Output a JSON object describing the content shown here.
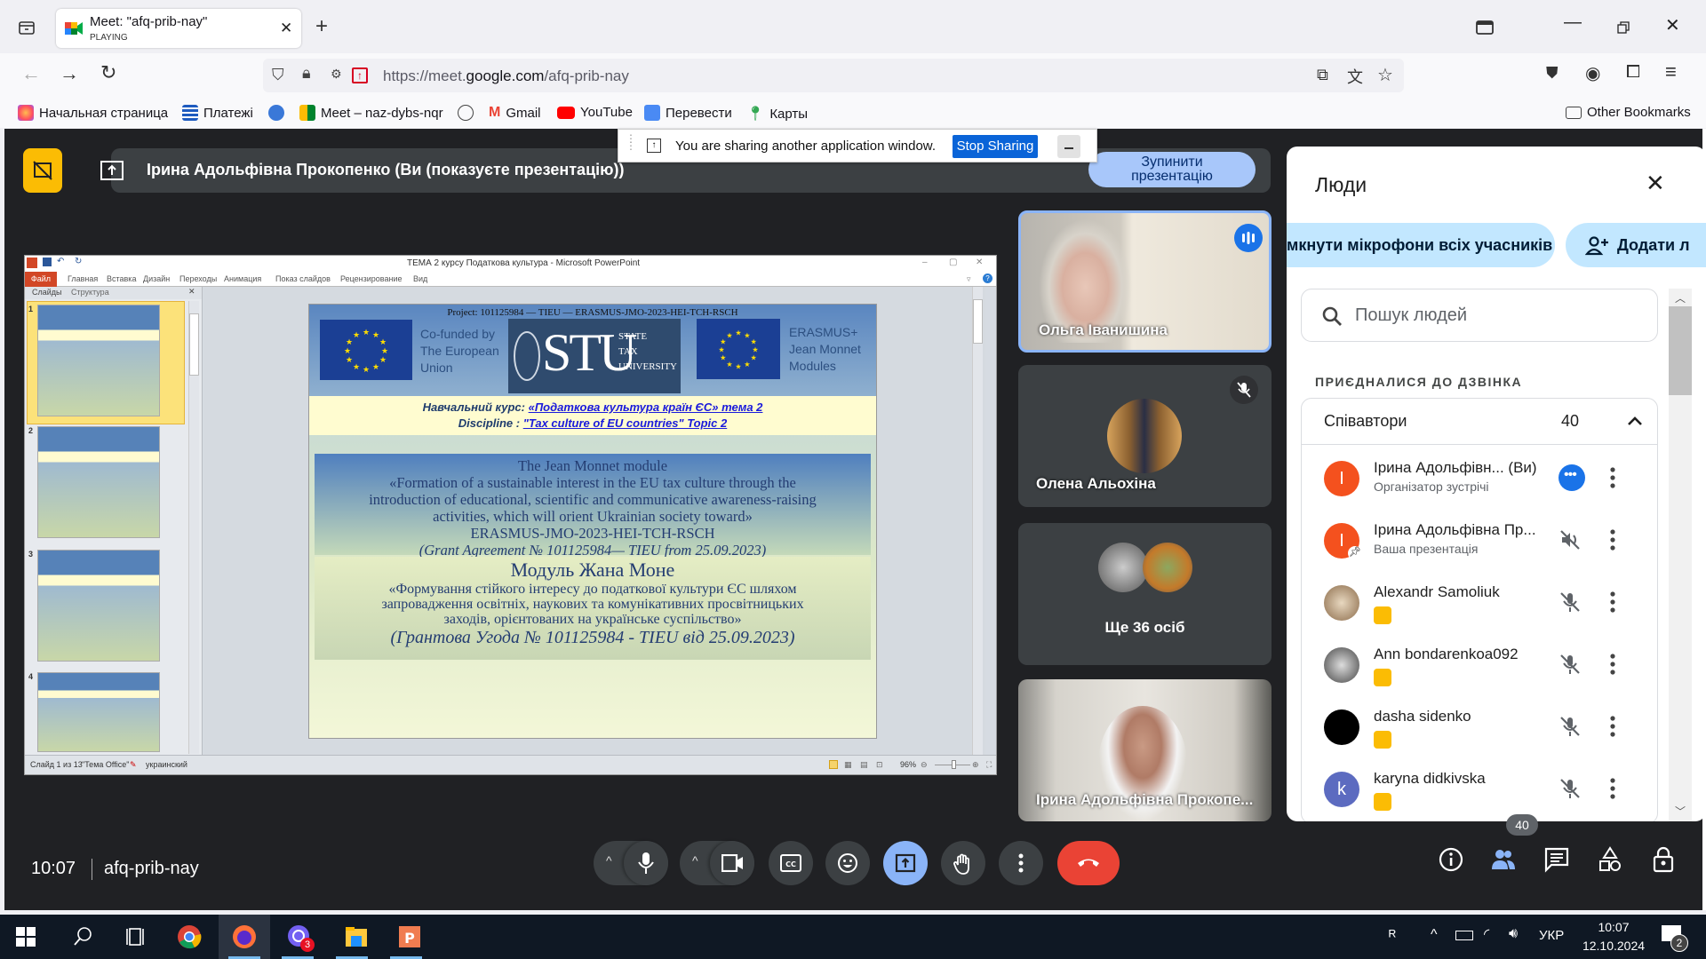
{
  "browser": {
    "tab": {
      "title": "Meet: \"afq-prib-nay\"",
      "status": "PLAYING"
    },
    "url": {
      "prefix": "https://meet.",
      "domain": "google.com",
      "path": "/afq-prib-nay"
    },
    "bookmarks": [
      {
        "label": "Начальная страница",
        "icon": "firefox-icon"
      },
      {
        "label": "Платежі",
        "icon": "payments-icon"
      },
      {
        "label": "",
        "icon": "mvp-icon"
      },
      {
        "label": "Meet – naz-dybs-nqr",
        "icon": "meet-icon"
      },
      {
        "label": "",
        "icon": "globe-icon"
      },
      {
        "label": "Gmail",
        "icon": "gmail-icon"
      },
      {
        "label": "YouTube",
        "icon": "youtube-icon"
      },
      {
        "label": "Перевести",
        "icon": "translate-icon"
      },
      {
        "label": "Карты",
        "icon": "maps-icon"
      }
    ],
    "other_bookmarks": "Other Bookmarks"
  },
  "share_notice": {
    "text": "You are sharing another application window.",
    "stop_label": "Stop Sharing"
  },
  "presenter": {
    "text": "Ірина Адольфівна Прокопенко (Ви (показуєте презентацію))",
    "stop_line1": "Зупинити",
    "stop_line2": "презентацію"
  },
  "powerpoint": {
    "title": "ТЕМА 2  курсу Податкова культура  -  Microsoft PowerPoint",
    "ribbon": [
      "Файл",
      "Главная",
      "Вставка",
      "Дизайн",
      "Переходы",
      "Анимация",
      "Показ слайдов",
      "Рецензирование",
      "Вид"
    ],
    "panel_tabs": [
      "Слайды",
      "Структура"
    ],
    "thumbnails": [
      "1",
      "2",
      "3",
      "4"
    ],
    "status": {
      "slide": "Слайд 1 из 13",
      "theme": "\"Тема Office\"",
      "lang": "украинский",
      "zoom": "96%"
    },
    "slide": {
      "project": "Project: 101125984 — TIEU — ERASMUS-JMO-2023-HEI-TCH-RSCH",
      "cofunded": [
        "Co-funded by",
        "The European",
        "Union"
      ],
      "stu_big": "STU",
      "stu_small": [
        "STATE",
        "TAX",
        "UNIVERSITY"
      ],
      "erasmus": [
        "ERASMUS+",
        "Jean Monnet",
        "Modules"
      ],
      "course_label": "Навчальний курс: ",
      "course_value": "«Податкова культура країн ЄС» тема 2",
      "discipline_label": "Discipline : ",
      "discipline_value": "\"Tax culture of EU countries\" Topic 2",
      "jm_lines": [
        "The Jean Monnet module",
        "«Formation of a sustainable interest in the EU tax culture through the",
        "introduction of educational, scientific and communicative awareness-raising",
        "activities, which will orient Ukrainian society toward»",
        "ERASMUS-JMO-2023-HEI-TCH-RSCH"
      ],
      "jm_grant": "(Grant Agreement № 101125984— TIEU from 25.09.2023)",
      "ua_title": "Модуль Жана Моне",
      "ua_lines": [
        "«Формування стійкого інтересу до податкової культури ЄС шляхом",
        "запровадження освітніх, наукових та комунікативних просвітницьких",
        "заходів, орієнтованих на українське суспільство»"
      ],
      "ua_grant": "(Грантова Угода №  101125984 - TIEU від 25.09.2023)"
    }
  },
  "tiles": [
    {
      "name": "Ольга Іванишина",
      "speaking": true
    },
    {
      "name": "Олена Альохіна",
      "muted": true
    },
    {
      "name": "Ще 36 осіб"
    },
    {
      "name": "Ірина Адольфівна Прокопе..."
    }
  ],
  "people_panel": {
    "title": "Люди",
    "mute_all": "Вимкнути мікрофони всіх учасників",
    "mute_all_visible": "мкнути мікрофони всіх учасників",
    "add_people": "Додати людей",
    "add_people_visible": "Додати л",
    "search_placeholder": "Пошук людей",
    "joined_label": "ПРИЄДНАЛИСЯ ДО ДЗВІНКА",
    "group": {
      "name": "Співавтори",
      "count": "40"
    },
    "participants": [
      {
        "name": "Ірина Адольфівн...   (Ви)",
        "sub": "Організатор зустрічі",
        "initial": "I",
        "color": "#f4511e"
      },
      {
        "name": "Ірина Адольфівна Пр...",
        "sub": "Ваша презентація",
        "initial": "I",
        "color": "#f4511e"
      },
      {
        "name": "Alexandr Samoliuk",
        "sub": "",
        "initial": "",
        "color": "#b08860"
      },
      {
        "name": "Ann bondarenkoa092",
        "sub": "",
        "initial": "",
        "color": "#6b6b6b"
      },
      {
        "name": "dasha sidenko",
        "sub": "",
        "initial": "",
        "color": "#000000"
      },
      {
        "name": "karyna didkivska",
        "sub": "",
        "initial": "k",
        "color": "#5c6bc0"
      }
    ]
  },
  "toolbar": {
    "time": "10:07",
    "meeting_code": "afq-prib-nay",
    "people_count": "40"
  },
  "taskbar": {
    "lang": "УКР",
    "time": "10:07",
    "date": "12.10.2024",
    "notifications": "2",
    "viber_badge": "3"
  },
  "colors": {
    "accent": "#8ab4f8",
    "end_call": "#ea4335",
    "panel_pill": "#c2e7ff"
  }
}
